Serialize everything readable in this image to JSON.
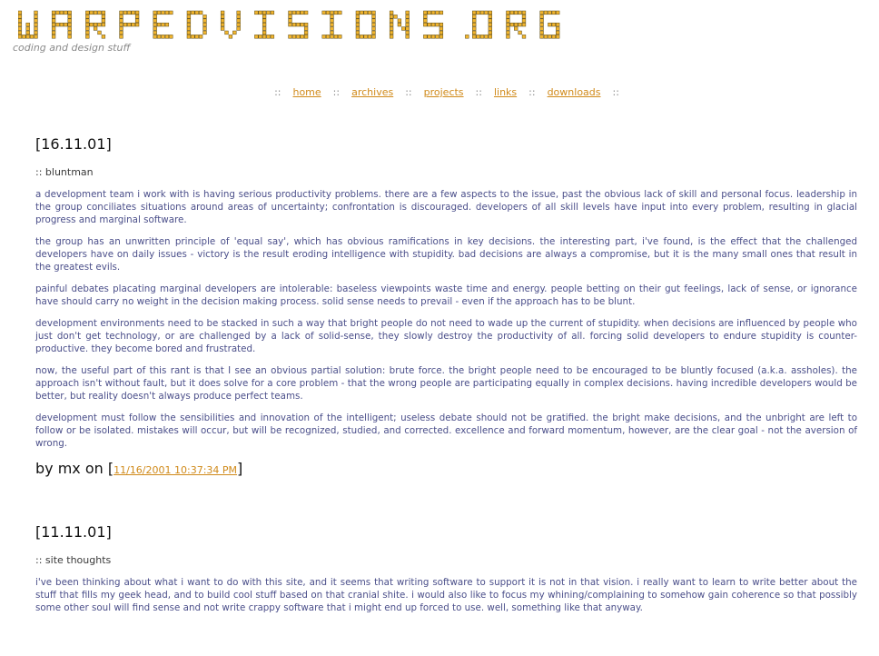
{
  "site": {
    "logo_text": "warpedvisions.org",
    "tagline": "coding and design stuff"
  },
  "nav": {
    "separator": "::",
    "items": [
      {
        "label": "home"
      },
      {
        "label": "archives"
      },
      {
        "label": "projects"
      },
      {
        "label": "links"
      },
      {
        "label": "downloads"
      }
    ]
  },
  "posts": [
    {
      "date": "[16.11.01]",
      "title": ":: bluntman",
      "paragraphs": [
        "a development team i work with is having serious productivity problems. there are a few aspects to the issue, past the obvious lack of skill and personal focus. leadership in the group conciliates situations around areas of uncertainty; confrontation is discouraged. developers of all skill levels have input into every problem, resulting in glacial progress and marginal software.",
        "the group has an unwritten principle of 'equal say', which has obvious ramifications in key decisions. the interesting part, i've found, is the effect that the challenged developers have on daily issues - victory is the result eroding intelligence with stupidity. bad decisions are always a compromise, but it is the many small ones that result in the greatest evils.",
        "painful debates placating marginal developers are intolerable: baseless viewpoints waste time and energy. people betting on their gut feelings, lack of sense, or ignorance have should carry no weight in the decision making process. solid sense needs to prevail - even if the approach has to be blunt.",
        "development environments need to be stacked in such a way that bright people do not need to wade up the current of stupidity. when decisions are influenced by people who just don't get technology, or are challenged by a lack of solid-sense, they slowly destroy the productivity of all. forcing solid developers to endure stupidity is counter-productive. they become bored and frustrated.",
        "now, the useful part of this rant is that I see an obvious partial solution: brute force. the bright people need to be encouraged to be bluntly focused (a.k.a. assholes). the approach isn't without fault, but it does solve for a core problem - that the wrong people are participating equally in complex decisions. having incredible developers would be better, but reality doesn't always produce perfect teams.",
        "development must follow the sensibilities and innovation of the intelligent; useless debate should not be gratified. the bright make decisions, and the unbright are left to follow or be isolated. mistakes will occur, but will be recognized, studied, and corrected. excellence and forward momentum, however, are the clear goal - not the aversion of wrong."
      ],
      "byline_prefix": "by mx on [",
      "byline_timestamp": "11/16/2001 10:37:34 PM",
      "byline_suffix": "]"
    },
    {
      "date": "[11.11.01]",
      "title": ":: site thoughts",
      "paragraphs": [
        "i've been thinking about what i want to do with this site, and it seems that writing software to support it is not in that vision. i really want to learn to write better about the stuff that fills my geek head, and to build cool stuff based on that cranial shite. i would also like to focus my whining/complaining to somehow gain coherence so that possibly some other soul will find sense and not write crappy software that i might end up forced to use. well, something like that anyway."
      ]
    }
  ],
  "colors": {
    "logo_fill": "#f2b52e",
    "logo_outline": "#5b4a14",
    "link": "#d08a1a",
    "body_text": "#4b4f8a"
  }
}
